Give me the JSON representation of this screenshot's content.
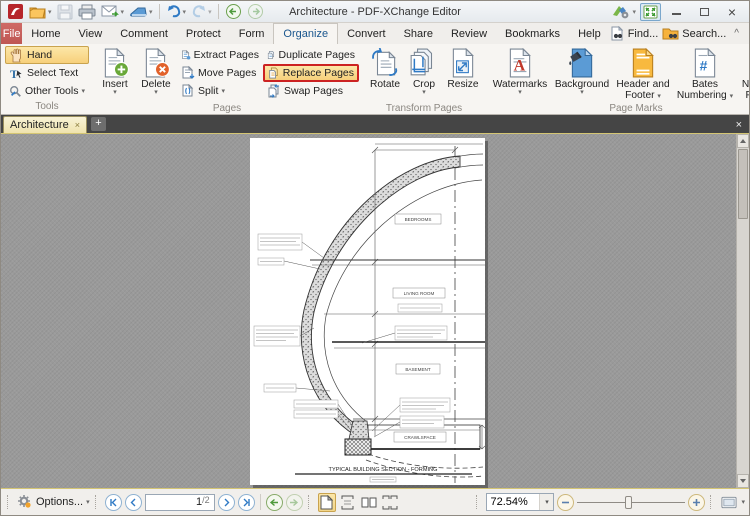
{
  "titlebar": {
    "title": "Architecture - PDF-XChange Editor"
  },
  "menubar": {
    "tabs": [
      "File",
      "Home",
      "View",
      "Comment",
      "Protect",
      "Form",
      "Organize",
      "Convert",
      "Share",
      "Review",
      "Bookmarks",
      "Help"
    ],
    "active_tab": "Organize",
    "find": "Find...",
    "search": "Search..."
  },
  "ribbon": {
    "tools": {
      "label": "Tools",
      "hand": "Hand",
      "select_text": "Select Text",
      "other_tools": "Other Tools"
    },
    "pages": {
      "label": "Pages",
      "insert": "Insert",
      "delete": "Delete",
      "extract": "Extract Pages",
      "move": "Move Pages",
      "split": "Split",
      "duplicate": "Duplicate Pages",
      "replace": "Replace Pages",
      "swap": "Swap Pages",
      "highlighted_item": "Replace Pages"
    },
    "transform": {
      "label": "Transform Pages",
      "rotate": "Rotate",
      "crop": "Crop",
      "resize": "Resize"
    },
    "page_marks": {
      "label": "Page Marks",
      "watermarks": "Watermarks",
      "background": "Background",
      "header_footer": "Header and Footer",
      "bates": "Bates Numbering",
      "number_pages": "Number Pages"
    }
  },
  "doc_tab": {
    "title": "Architecture"
  },
  "drawing": {
    "labels": {
      "bedrooms": "BEDROOMS",
      "living_room": "LIVING ROOM",
      "basement": "BASEMENT",
      "crawlspace": "CRAWLSPACE"
    },
    "title": "TYPICAL BUILDING SECTION - FORMING"
  },
  "statusbar": {
    "options": "Options...",
    "page_current": "1",
    "page_separator": "/",
    "page_total": "2",
    "zoom": "72.54%"
  },
  "icons": {
    "caret": "▾",
    "close": "×",
    "plus": "+",
    "collapse": "^"
  },
  "colors": {
    "callout_red": "#cc2222",
    "active_highlight": "#fce7a8",
    "file_tab_red": "#c4605c",
    "doc_tab_gold": "#d4c573",
    "accent_blue": "#2f7ac5"
  }
}
